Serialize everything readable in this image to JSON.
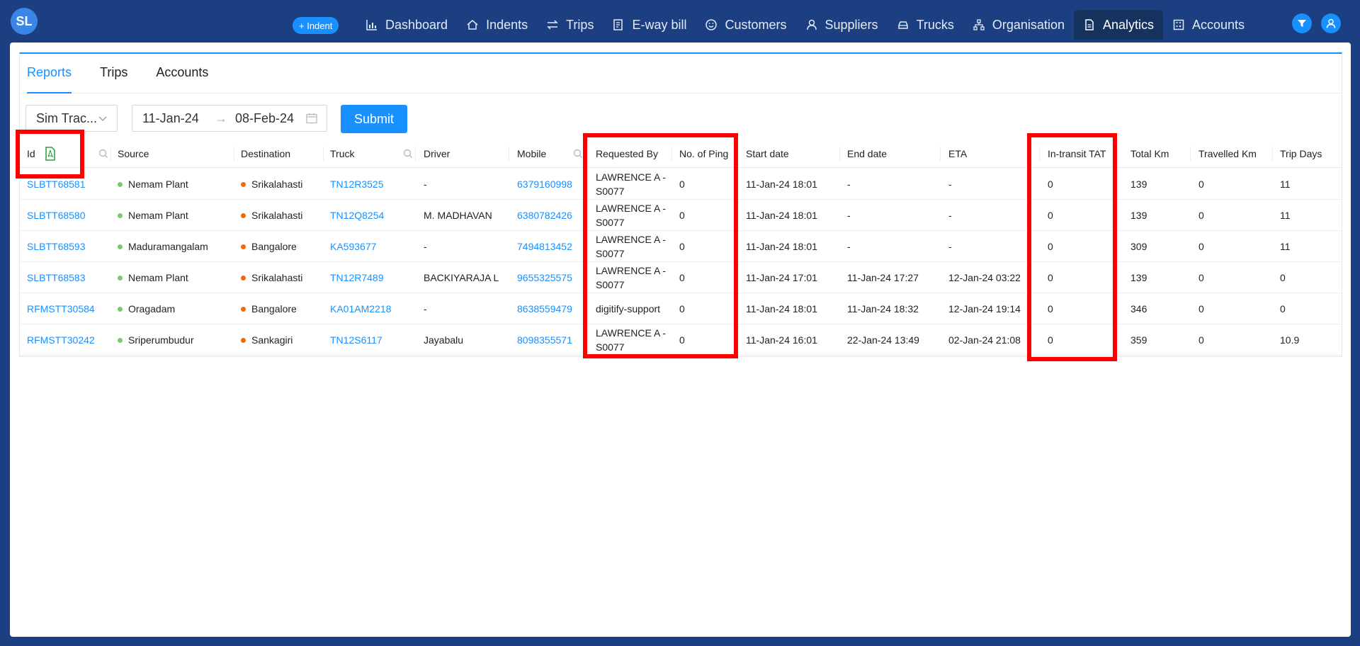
{
  "app": {
    "logo_text": "SL"
  },
  "topbar": {
    "indent_button": "+ Indent",
    "nav": [
      {
        "label": "Dashboard",
        "icon": "bar-chart-icon"
      },
      {
        "label": "Indents",
        "icon": "home-icon"
      },
      {
        "label": "Trips",
        "icon": "swap-icon"
      },
      {
        "label": "E-way bill",
        "icon": "receipt-icon"
      },
      {
        "label": "Customers",
        "icon": "smile-icon"
      },
      {
        "label": "Suppliers",
        "icon": "user-icon"
      },
      {
        "label": "Trucks",
        "icon": "car-icon"
      },
      {
        "label": "Organisation",
        "icon": "cluster-icon"
      },
      {
        "label": "Analytics",
        "icon": "file-icon",
        "active": true
      },
      {
        "label": "Accounts",
        "icon": "calculator-icon"
      }
    ]
  },
  "tabs": [
    {
      "label": "Reports",
      "active": true
    },
    {
      "label": "Trips"
    },
    {
      "label": "Accounts"
    }
  ],
  "filters": {
    "report_type": "Sim Trac...",
    "date_from": "11-Jan-24",
    "date_arrow": "→",
    "date_to": "08-Feb-24",
    "submit_label": "Submit"
  },
  "table": {
    "columns": [
      "Id",
      "Source",
      "Destination",
      "Truck",
      "Driver",
      "Mobile",
      "Requested By",
      "No. of Ping",
      "Start date",
      "End date",
      "ETA",
      "In-transit TAT",
      "Total Km",
      "Travelled Km",
      "Trip Days"
    ],
    "rows": [
      {
        "id": "SLBTT68581",
        "source": "Nemam Plant",
        "destination": "Srikalahasti",
        "truck": "TN12R3525",
        "driver": "-",
        "mobile": "6379160998",
        "requested_by": "LAWRENCE A - S0077",
        "pings": "0",
        "start": "11-Jan-24 18:01",
        "end": "-",
        "eta": "-",
        "tat": "0",
        "total_km": "139",
        "travelled_km": "0",
        "trip_days": "11"
      },
      {
        "id": "SLBTT68580",
        "source": "Nemam Plant",
        "destination": "Srikalahasti",
        "truck": "TN12Q8254",
        "driver": "M. MADHAVAN",
        "mobile": "6380782426",
        "requested_by": "LAWRENCE A - S0077",
        "pings": "0",
        "start": "11-Jan-24 18:01",
        "end": "-",
        "eta": "-",
        "tat": "0",
        "total_km": "139",
        "travelled_km": "0",
        "trip_days": "11"
      },
      {
        "id": "SLBTT68593",
        "source": "Maduramangalam",
        "destination": "Bangalore",
        "truck": "KA593677",
        "driver": "-",
        "mobile": "7494813452",
        "requested_by": "LAWRENCE A - S0077",
        "pings": "0",
        "start": "11-Jan-24 18:01",
        "end": "-",
        "eta": "-",
        "tat": "0",
        "total_km": "309",
        "travelled_km": "0",
        "trip_days": "11"
      },
      {
        "id": "SLBTT68583",
        "source": "Nemam Plant",
        "destination": "Srikalahasti",
        "truck": "TN12R7489",
        "driver": "BACKIYARAJA L",
        "mobile": "9655325575",
        "requested_by": "LAWRENCE A - S0077",
        "pings": "0",
        "start": "11-Jan-24 17:01",
        "end": "11-Jan-24 17:27",
        "eta": "12-Jan-24 03:22",
        "tat": "0",
        "total_km": "139",
        "travelled_km": "0",
        "trip_days": "0"
      },
      {
        "id": "RFMSTT30584",
        "source": "Oragadam",
        "destination": "Bangalore",
        "truck": "KA01AM2218",
        "driver": "-",
        "mobile": "8638559479",
        "requested_by": "digitify-support",
        "pings": "0",
        "start": "11-Jan-24 18:01",
        "end": "11-Jan-24 18:32",
        "eta": "12-Jan-24 19:14",
        "tat": "0",
        "total_km": "346",
        "travelled_km": "0",
        "trip_days": "0"
      },
      {
        "id": "RFMSTT30242",
        "source": "Sriperumbudur",
        "destination": "Sankagiri",
        "truck": "TN12S6117",
        "driver": "Jayabalu",
        "mobile": "8098355571",
        "requested_by": "LAWRENCE A - S0077",
        "pings": "0",
        "start": "11-Jan-24 16:01",
        "end": "22-Jan-24 13:49",
        "eta": "02-Jan-24 21:08",
        "tat": "0",
        "total_km": "359",
        "travelled_km": "0",
        "trip_days": "10.9"
      }
    ]
  },
  "colors": {
    "brand": "#1b3f80",
    "accent": "#1890ff",
    "highlight": "#ff0000"
  }
}
